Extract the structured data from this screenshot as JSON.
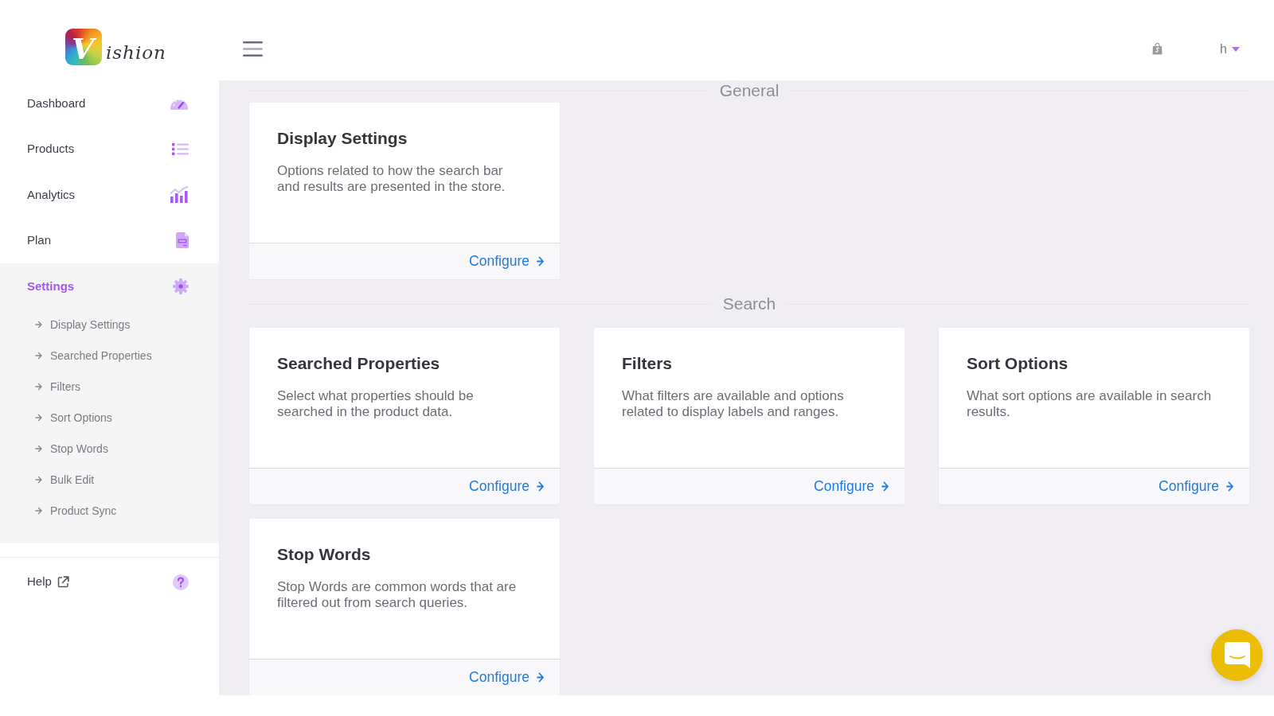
{
  "header": {
    "logo": "Vishion",
    "user": "h"
  },
  "sidebar": {
    "items": [
      {
        "label": "Dashboard",
        "kind": "dashboard",
        "selected": false
      },
      {
        "label": "Products",
        "kind": "products",
        "selected": false
      },
      {
        "label": "Analytics",
        "kind": "analytics",
        "selected": false
      },
      {
        "label": "Plan",
        "kind": "plan",
        "selected": false
      },
      {
        "label": "Settings",
        "kind": "settings",
        "selected": true,
        "expanded": true,
        "children": [
          {
            "label": "Display Settings",
            "selected": false
          },
          {
            "label": "Searched Properties",
            "selected": false
          },
          {
            "label": "Filters",
            "selected": false
          },
          {
            "label": "Sort Options",
            "selected": false
          },
          {
            "label": "Stop Words",
            "selected": false
          },
          {
            "label": "Bulk Edit",
            "selected": false
          },
          {
            "label": "Product Sync",
            "selected": false
          }
        ]
      }
    ],
    "help": {
      "label": "Help"
    }
  },
  "sections": [
    {
      "title": "General",
      "cards": [
        {
          "title": "Display Settings",
          "description": "Options related to how the search bar and results are presented in the store.",
          "action": "Configure"
        }
      ]
    },
    {
      "title": "Search",
      "cards": [
        {
          "title": "Searched Properties",
          "description": "Select what properties should be searched in the product data.",
          "action": "Configure"
        },
        {
          "title": "Filters",
          "description": "What filters are available and options related to display labels and ranges.",
          "action": "Configure"
        },
        {
          "title": "Sort Options",
          "description": "What sort options are available in search results.",
          "action": "Configure"
        },
        {
          "title": "Stop Words",
          "description": "Stop Words are common words that are filtered out from search queries.",
          "action": "Configure"
        }
      ]
    }
  ]
}
